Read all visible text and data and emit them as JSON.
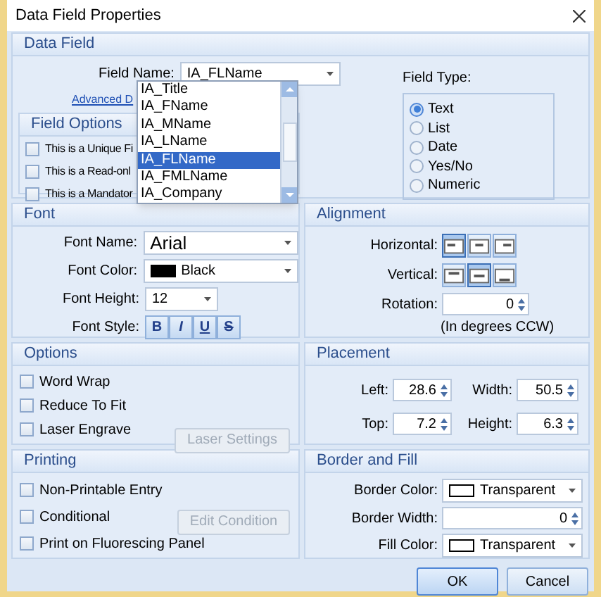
{
  "window": {
    "title": "Data Field Properties"
  },
  "data_field": {
    "header": "Data Field",
    "field_name_label": "Field Name:",
    "field_name_value": "IA_FLName",
    "advanced_link": "Advanced D",
    "field_type_label": "Field Type:",
    "field_types": [
      {
        "label": "Text",
        "selected": true
      },
      {
        "label": "List",
        "selected": false
      },
      {
        "label": "Date",
        "selected": false
      },
      {
        "label": "Yes/No",
        "selected": false
      },
      {
        "label": "Numeric",
        "selected": false
      }
    ],
    "dropdown_items": [
      {
        "label": "IA_Title",
        "selected": false
      },
      {
        "label": "IA_FName",
        "selected": false
      },
      {
        "label": "IA_MName",
        "selected": false
      },
      {
        "label": "IA_LName",
        "selected": false
      },
      {
        "label": "IA_FLName",
        "selected": true
      },
      {
        "label": "IA_FMLName",
        "selected": false
      },
      {
        "label": "IA_Company",
        "selected": false
      }
    ],
    "field_options": {
      "header": "Field Options",
      "items": [
        {
          "label": "This is a Unique Fi",
          "checked": false
        },
        {
          "label": "This is a Read-onl",
          "checked": false
        },
        {
          "label": "This is a Mandator",
          "checked": false
        }
      ]
    }
  },
  "font": {
    "header": "Font",
    "name_label": "Font Name:",
    "name_value": "Arial",
    "color_label": "Font Color:",
    "color_value": "Black",
    "height_label": "Font Height:",
    "height_value": "12",
    "style_label": "Font Style:",
    "style_buttons": [
      {
        "label": "B",
        "kind": "bold"
      },
      {
        "label": "I",
        "kind": "italic"
      },
      {
        "label": "U",
        "kind": "underline"
      },
      {
        "label": "S",
        "kind": "strike"
      }
    ]
  },
  "alignment": {
    "header": "Alignment",
    "horizontal_label": "Horizontal:",
    "horizontal": [
      {
        "selected": true
      },
      {
        "selected": false
      },
      {
        "selected": false
      }
    ],
    "vertical_label": "Vertical:",
    "vertical": [
      {
        "selected": false
      },
      {
        "selected": true
      },
      {
        "selected": false
      }
    ],
    "rotation_label": "Rotation:",
    "rotation_value": "0",
    "rotation_note": "(In degrees CCW)"
  },
  "options": {
    "header": "Options",
    "items": [
      {
        "label": "Word Wrap",
        "checked": false
      },
      {
        "label": "Reduce To Fit",
        "checked": false
      },
      {
        "label": "Laser Engrave",
        "checked": false
      }
    ],
    "button": {
      "label": "Laser Settings",
      "disabled": true
    }
  },
  "placement": {
    "header": "Placement",
    "left_label": "Left:",
    "left_value": "28.6",
    "width_label": "Width:",
    "width_value": "50.5",
    "top_label": "Top:",
    "top_value": "7.2",
    "height_label": "Height:",
    "height_value": "6.3"
  },
  "printing": {
    "header": "Printing",
    "items": [
      {
        "label": "Non-Printable Entry",
        "checked": false
      },
      {
        "label": "Conditional",
        "checked": false
      },
      {
        "label": "Print on Fluorescing Panel",
        "checked": false
      }
    ],
    "button": {
      "label": "Edit Condition",
      "disabled": true
    }
  },
  "border_fill": {
    "header": "Border and Fill",
    "border_color_label": "Border Color:",
    "border_color_value": "Transparent",
    "border_width_label": "Border Width:",
    "border_width_value": "0",
    "fill_color_label": "Fill Color:",
    "fill_color_value": "Transparent"
  },
  "buttons": [
    {
      "label": "OK",
      "kind": "primary"
    },
    {
      "label": "Cancel",
      "kind": "normal"
    }
  ]
}
